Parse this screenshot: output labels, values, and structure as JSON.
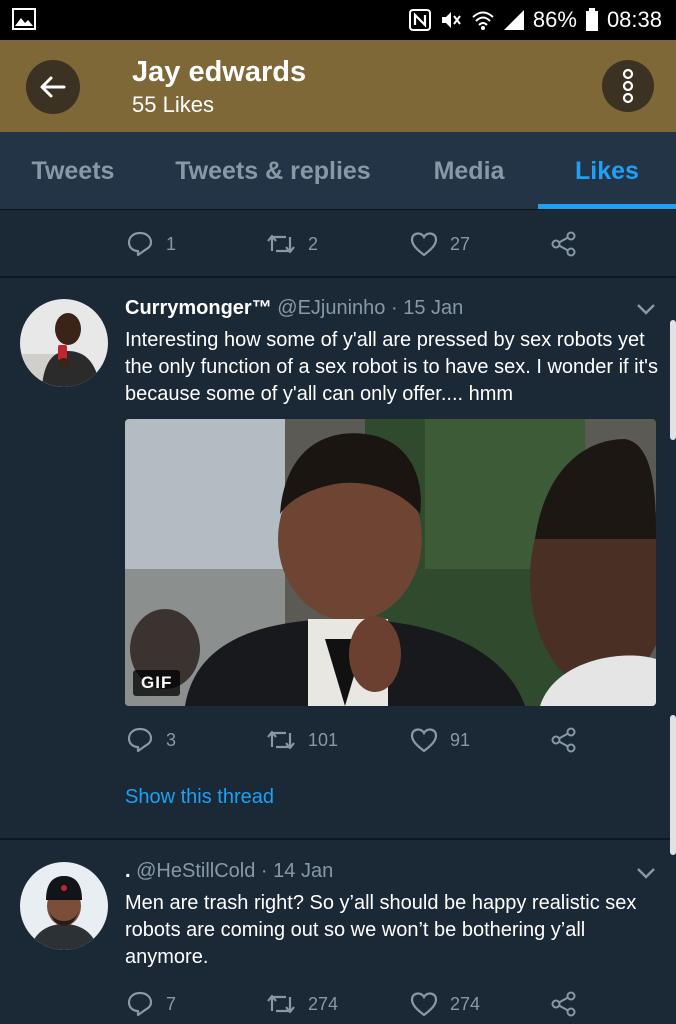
{
  "status_bar": {
    "battery": "86%",
    "time": "08:38",
    "icons": [
      "image-icon",
      "nfc-icon",
      "mute-icon",
      "wifi-icon",
      "signal-icon",
      "battery-icon"
    ]
  },
  "header": {
    "title": "Jay edwards",
    "subtitle": "55 Likes"
  },
  "tabs": [
    {
      "label": "Tweets"
    },
    {
      "label": "Tweets & replies"
    },
    {
      "label": "Media"
    },
    {
      "label": "Likes",
      "active": true
    }
  ],
  "tweets": [
    {
      "replies": "1",
      "retweets": "2",
      "likes": "27"
    },
    {
      "name": "Currymonger™",
      "handle": "@EJjuninho",
      "sep": " · ",
      "date": "15 Jan",
      "text": "Interesting how some of y'all are pressed by sex robots yet the only function of a sex robot is to have sex. I wonder if it's because some of y'all can only offer.... hmm",
      "media_badge": "GIF",
      "replies": "3",
      "retweets": "101",
      "likes": "91",
      "show_thread": "Show this thread"
    },
    {
      "name": ".",
      "handle": "@HeStillCold",
      "sep": " · ",
      "date": "14 Jan",
      "text": "Men are trash right? So y’all should be happy realistic sex robots are coming out so we won’t be bothering y’all anymore.",
      "replies": "7",
      "retweets": "274",
      "likes": "274"
    }
  ],
  "colors": {
    "header_bg": "#7f6838",
    "tabs_bg": "#243447",
    "feed_bg": "#1b2836",
    "accent": "#1da1f2",
    "muted": "#8899a6"
  }
}
